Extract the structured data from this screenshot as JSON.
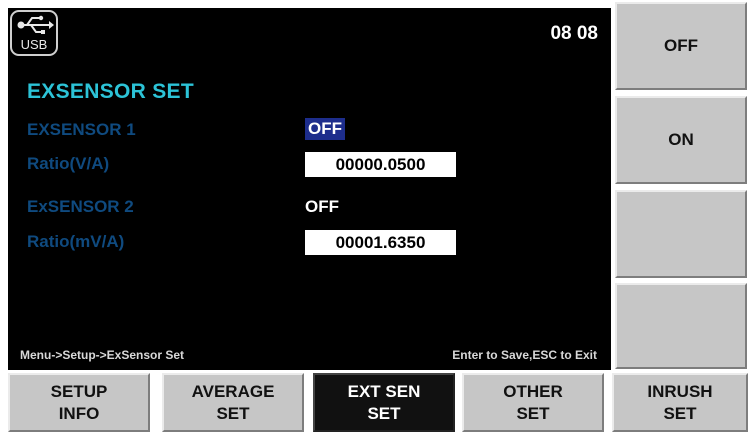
{
  "status_bar": {
    "usb_label": "USB",
    "time": "08 08"
  },
  "screen": {
    "title": "EXSENSOR SET",
    "rows": [
      {
        "label": "EXSENSOR 1",
        "value": "OFF"
      },
      {
        "label": "Ratio(V/A)",
        "value": "00000.0500"
      },
      {
        "label": "ExSENSOR 2",
        "value": "OFF"
      },
      {
        "label": "Ratio(mV/A)",
        "value": "00001.6350"
      }
    ],
    "breadcrumb": "Menu->Setup->ExSensor Set",
    "hint": "Enter to Save,ESC to Exit"
  },
  "side_keys": [
    "OFF",
    "ON",
    "",
    ""
  ],
  "bottom_keys": [
    {
      "line1": "SETUP",
      "line2": "INFO"
    },
    {
      "line1": "AVERAGE",
      "line2": "SET"
    },
    {
      "line1": "EXT SEN",
      "line2": "SET"
    },
    {
      "line1": "OTHER",
      "line2": "SET"
    },
    {
      "line1": "INRUSH",
      "line2": "SET"
    }
  ],
  "colors": {
    "title": "#2cc3d7",
    "label": "#0f4a7f",
    "selected_bg": "#1d2d8c",
    "key_bg": "#c6c6c6"
  },
  "icons": {
    "usb": "usb-icon"
  }
}
